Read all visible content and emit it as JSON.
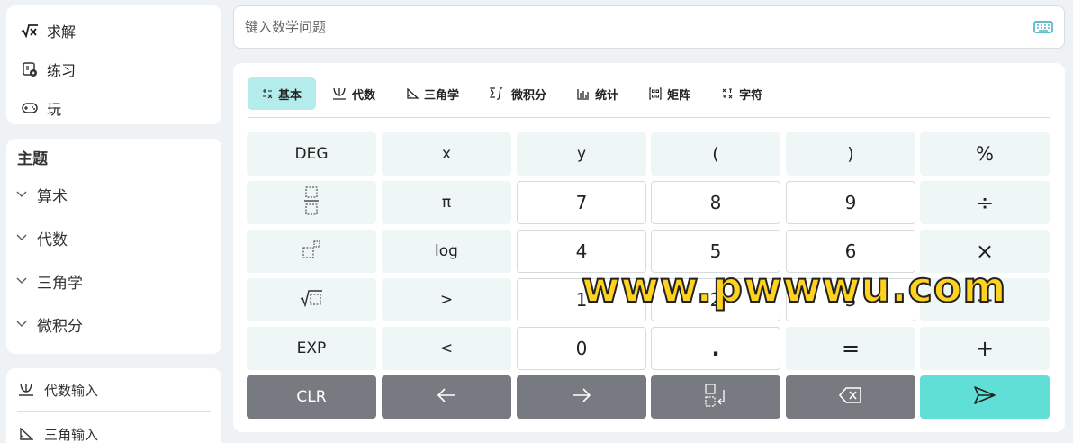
{
  "modes": [
    {
      "label": "求解",
      "icon": "sqrt-x-icon"
    },
    {
      "label": "练习",
      "icon": "practice-icon"
    },
    {
      "label": "玩",
      "icon": "gamepad-icon"
    }
  ],
  "topics": {
    "heading": "主题",
    "items": [
      "算术",
      "代数",
      "三角学",
      "微积分"
    ]
  },
  "inputs": [
    "代数输入",
    "三角输入"
  ],
  "search": {
    "placeholder": "键入数学问题"
  },
  "tabs": [
    {
      "label": "基本",
      "icon": "basic-ops-icon",
      "active": true
    },
    {
      "label": "代数",
      "icon": "algebra-icon"
    },
    {
      "label": "三角学",
      "icon": "triangle-icon"
    },
    {
      "label": "微积分",
      "icon": "calculus-icon"
    },
    {
      "label": "统计",
      "icon": "stats-icon"
    },
    {
      "label": "矩阵",
      "icon": "matrix-icon"
    },
    {
      "label": "字符",
      "icon": "chars-icon"
    }
  ],
  "keys": {
    "deg": "DEG",
    "x": "x",
    "y": "y",
    "lparen": "(",
    "rparen": ")",
    "percent": "%",
    "pi": "π",
    "n7": "7",
    "n8": "8",
    "n9": "9",
    "divide": "÷",
    "log": "log",
    "n4": "4",
    "n5": "5",
    "n6": "6",
    "times": "×",
    "gt": ">",
    "n1": "1",
    "n2": "2",
    "n3": "3",
    "minus": "−",
    "exp": "EXP",
    "lt": "<",
    "n0": "0",
    "dot": ".",
    "equals": "=",
    "plus": "+",
    "clr": "CLR"
  },
  "watermark": "www.pwwwu.com",
  "colors": {
    "accent": "#5fdfd6",
    "active_tab": "#b3eceb",
    "dark_key": "#777a80"
  }
}
